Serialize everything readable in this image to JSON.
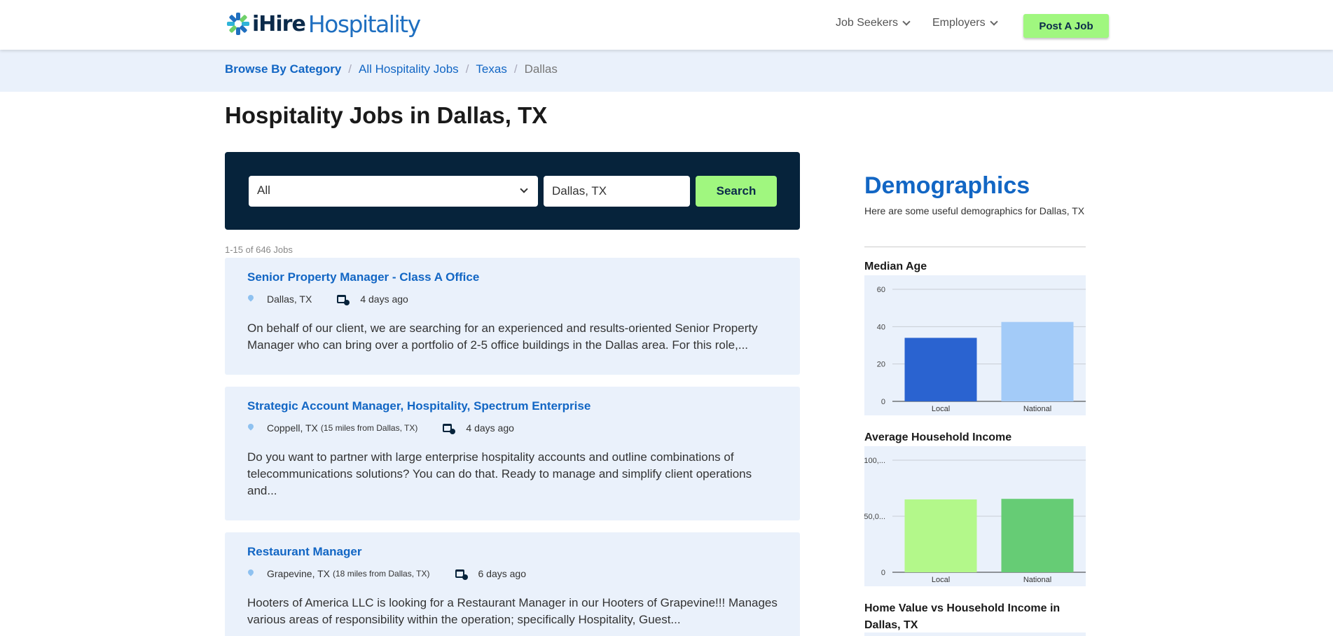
{
  "header": {
    "logo_ihire": "iHire",
    "logo_hospitality": "Hospitality",
    "nav_job_seekers": "Job Seekers",
    "nav_employers": "Employers",
    "post_job": "Post A Job"
  },
  "breadcrumb": {
    "browse": "Browse By Category",
    "all_jobs": "All Hospitality Jobs",
    "state": "Texas",
    "city": "Dallas"
  },
  "page_title": "Hospitality Jobs in Dallas, TX",
  "search": {
    "category_value": "All",
    "location_value": "Dallas, TX",
    "button": "Search"
  },
  "results_count": "1-15 of 646 Jobs",
  "jobs": [
    {
      "title": "Senior Property Manager - Class A Office",
      "location": "Dallas, TX",
      "distance": "",
      "posted": "4 days ago",
      "description": "On behalf of our client, we are searching for an experienced and results-oriented Senior Property Manager who can bring over a portfolio of 2-5 office buildings in the Dallas area. For this role,..."
    },
    {
      "title": "Strategic Account Manager, Hospitality, Spectrum Enterprise",
      "location": "Coppell, TX",
      "distance": "(15 miles from Dallas, TX)",
      "posted": "4 days ago",
      "description": "Do you want to partner with large enterprise hospitality accounts and outline combinations of telecommunications solutions? You can do that. Ready to manage and simplify client operations and..."
    },
    {
      "title": "Restaurant Manager",
      "location": "Grapevine, TX",
      "distance": "(18 miles from Dallas, TX)",
      "posted": "6 days ago",
      "description": "Hooters of America LLC is looking for a Restaurant Manager in our Hooters of Grapevine!!! Manages various areas of responsibility within the operation; specifically Hospitality, Guest..."
    }
  ],
  "demographics": {
    "title": "Demographics",
    "subtitle": "Here are some useful demographics for Dallas, TX",
    "home_value_title": "Home Value vs Household Income in Dallas, TX"
  },
  "chart_data": [
    {
      "type": "bar",
      "title": "Median Age",
      "categories": [
        "Local",
        "National"
      ],
      "values": [
        34,
        42.5
      ],
      "colors": [
        "#2a63d0",
        "#a3cbf8"
      ],
      "ylim": [
        0,
        60
      ],
      "yticks": [
        0,
        20,
        40,
        60
      ],
      "ytick_labels": [
        "0",
        "20",
        "40",
        "60"
      ],
      "grid": true
    },
    {
      "type": "bar",
      "title": "Average Household Income",
      "categories": [
        "Local",
        "National"
      ],
      "values": [
        65000,
        65500
      ],
      "colors": [
        "#b3f88a",
        "#66cc75"
      ],
      "ylim": [
        0,
        100000
      ],
      "yticks": [
        0,
        50000,
        100000
      ],
      "ytick_labels": [
        "0",
        "50,0...",
        "100,..."
      ],
      "grid": true
    }
  ]
}
